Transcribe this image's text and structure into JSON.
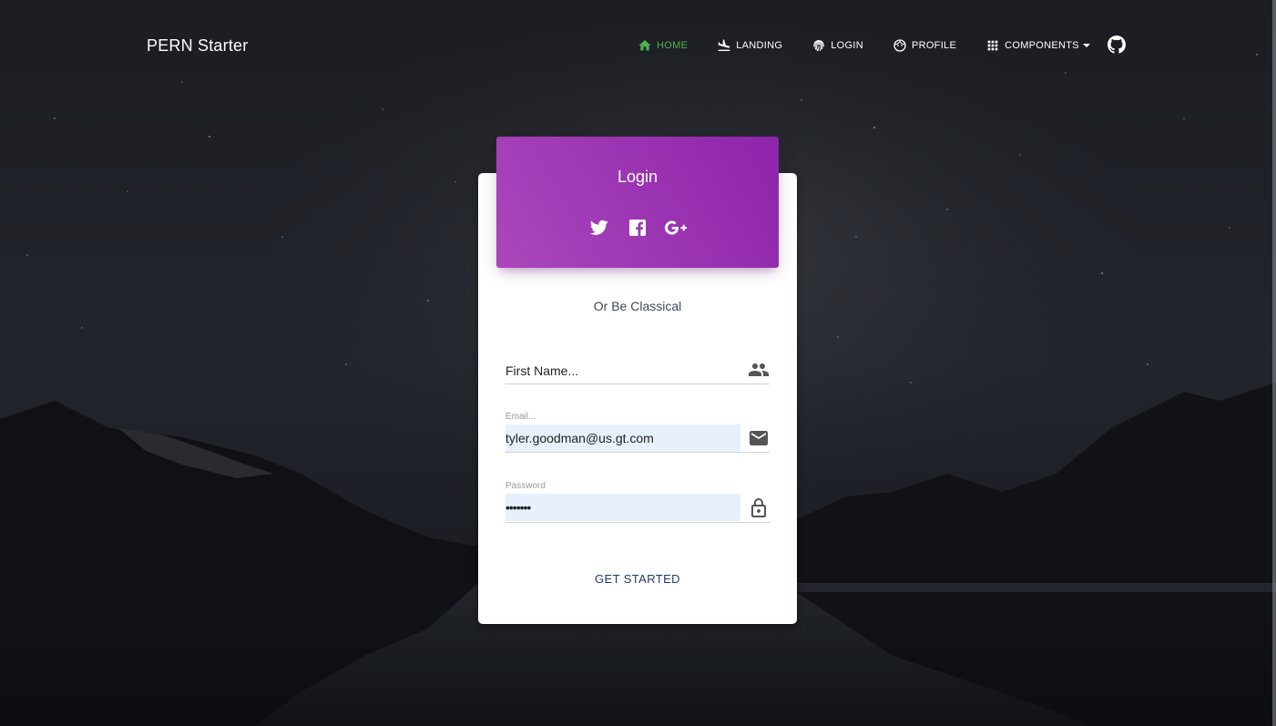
{
  "navbar": {
    "brand": "PERN Starter",
    "items": [
      {
        "label": "HOME",
        "icon": "home-icon",
        "active": true
      },
      {
        "label": "LANDING",
        "icon": "landing-icon",
        "active": false
      },
      {
        "label": "LOGIN",
        "icon": "fingerprint-icon",
        "active": false
      },
      {
        "label": "PROFILE",
        "icon": "face-icon",
        "active": false
      },
      {
        "label": "COMPONENTS",
        "icon": "apps-grid-icon",
        "active": false
      }
    ],
    "github_icon": "github-icon"
  },
  "login_card": {
    "title": "Login",
    "socials": [
      "twitter-icon",
      "facebook-icon",
      "google-plus-icon"
    ],
    "subtitle": "Or Be Classical",
    "first_name": {
      "placeholder": "First Name...",
      "value": ""
    },
    "email": {
      "label": "Email...",
      "value": "tyler.goodman@us.gt.com"
    },
    "password": {
      "label": "Password",
      "value": "•••••••"
    },
    "submit_label": "GET STARTED"
  },
  "colors": {
    "accent_active": "#4caf50",
    "header_gradient_start": "#ab47bc",
    "header_gradient_end": "#8e24aa",
    "button_text": "#1e3a6b",
    "autofill_bg": "#e8f0fe"
  }
}
